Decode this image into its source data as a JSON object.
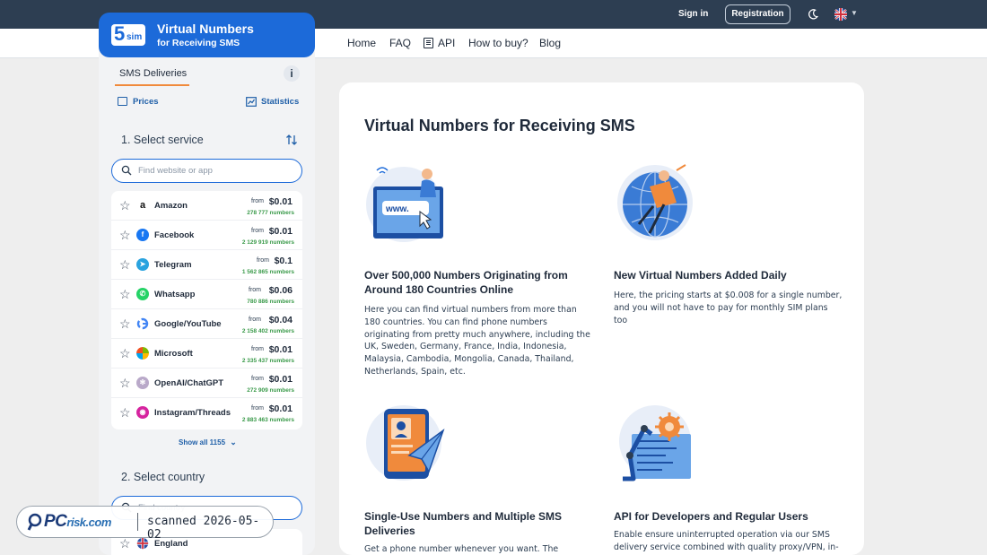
{
  "brand": {
    "logo_mark": "5",
    "logo_mark_small": "sim",
    "title": "Virtual Numbers",
    "subtitle": "for Receiving SMS"
  },
  "topbar": {
    "sign_in": "Sign in",
    "registration": "Registration",
    "theme_icon": "moon-icon",
    "language_flag": "uk-flag-icon"
  },
  "nav": {
    "items": [
      "Home",
      "FAQ",
      "API",
      "How to buy?",
      "Blog"
    ]
  },
  "sidebar": {
    "tab_label": "SMS Deliveries",
    "info_label": "i",
    "prices_label": "Prices",
    "statistics_label": "Statistics",
    "step1_title": "1. Select service",
    "service_search_placeholder": "Find website or app",
    "services": [
      {
        "name": "Amazon",
        "from": "from",
        "price": "$0.01",
        "count": "278 777 numbers",
        "icon": "amazon-icon",
        "color": "#ffffff"
      },
      {
        "name": "Facebook",
        "from": "from",
        "price": "$0.01",
        "count": "2 129 919 numbers",
        "icon": "facebook-icon",
        "color": "#1877f2"
      },
      {
        "name": "Telegram",
        "from": "from",
        "price": "$0.1",
        "count": "1 562 865 numbers",
        "icon": "telegram-icon",
        "color": "#2aa3df"
      },
      {
        "name": "Whatsapp",
        "from": "from",
        "price": "$0.06",
        "count": "780 886 numbers",
        "icon": "whatsapp-icon",
        "color": "#25d366"
      },
      {
        "name": "Google/YouTube",
        "from": "from",
        "price": "$0.04",
        "count": "2 158 402 numbers",
        "icon": "google-icon",
        "color": "#ffffff"
      },
      {
        "name": "Microsoft",
        "from": "from",
        "price": "$0.01",
        "count": "2 335 437 numbers",
        "icon": "microsoft-icon",
        "color": "#ffffff"
      },
      {
        "name": "OpenAI/ChatGPT",
        "from": "from",
        "price": "$0.01",
        "count": "272 909 numbers",
        "icon": "openai-icon",
        "color": "#b9a9c9"
      },
      {
        "name": "Instagram/Threads",
        "from": "from",
        "price": "$0.01",
        "count": "2 883 463 numbers",
        "icon": "instagram-icon",
        "color": "#d6249f"
      }
    ],
    "show_all": "Show all 1155",
    "step2_title": "2. Select country",
    "country_search_placeholder": "Find country",
    "countries": [
      {
        "name": "England",
        "icon": "uk-flag-icon"
      }
    ]
  },
  "main": {
    "title": "Virtual Numbers for Receiving SMS",
    "features": [
      {
        "title": "Over 500,000 Numbers Originating from Around 180 Countries Online",
        "text": "Here you can find virtual numbers from more than 180 countries. You can find phone numbers originating from pretty much anywhere, including the UK, Sweden, Germany, France, India, Indonesia, Malaysia, Cambodia, Mongolia, Canada, Thailand, Netherlands, Spain, etc.",
        "illustration": "laptop-www-illustration",
        "www": "www."
      },
      {
        "title": "New Virtual Numbers Added Daily",
        "text": "Here, the pricing starts at $0.008 for a single number, and you will not have to pay for monthly SIM plans too",
        "illustration": "globe-courier-illustration"
      },
      {
        "title": "Single-Use Numbers and Multiple SMS Deliveries",
        "text": "Get a phone number whenever you want. The process",
        "illustration": "phone-paper-plane-illustration"
      },
      {
        "title": "API for Developers and Regular Users",
        "text": "Enable ensure uninterrupted operation via our SMS delivery service combined with quality proxy/VPN, in-",
        "illustration": "robot-arm-gear-illustration"
      }
    ]
  },
  "watermark": {
    "logo_pc": "PC",
    "logo_risk": "risk.com",
    "text": "scanned 2026-05-02"
  },
  "colors": {
    "topbar": "#2d3e52",
    "brand_blue": "#1c6ad9",
    "accent_orange": "#f08a3c",
    "link_blue": "#1f5fa8",
    "count_green": "#3a9a4a"
  }
}
